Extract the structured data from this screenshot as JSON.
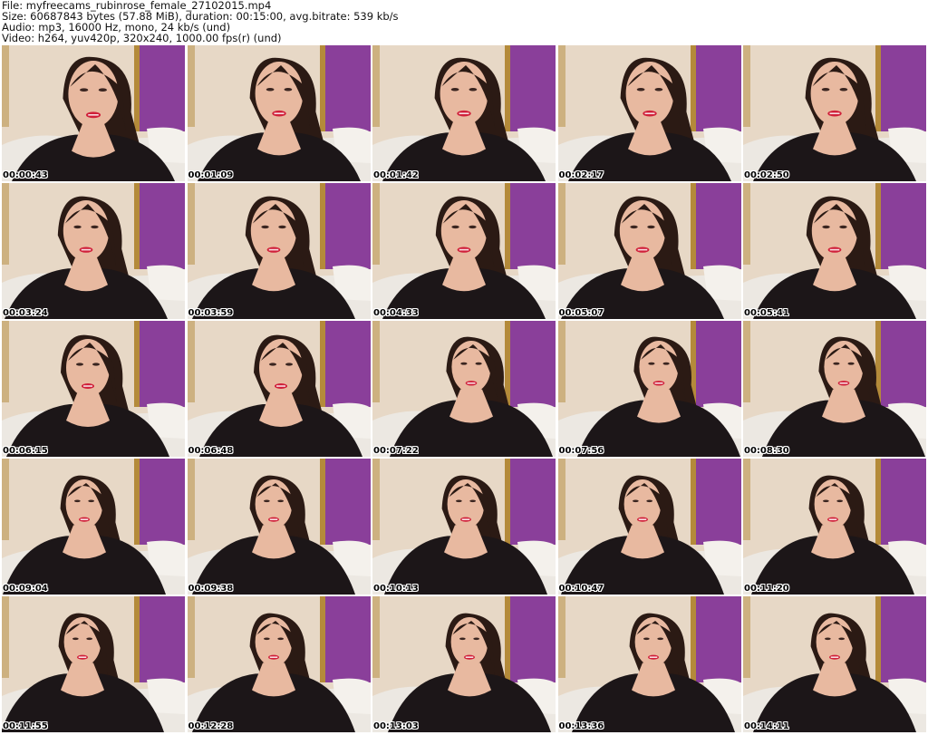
{
  "header": {
    "file_line": "File: myfreecams_rubinrose_female_27102015.mp4",
    "size_line": "Size: 60687843 bytes (57.88 MiB), duration: 00:15:00, avg.bitrate: 539 kb/s",
    "audio_line": "Audio: mp3, 16000 Hz, mono, 24 kb/s (und)",
    "video_line": "Video: h264, yuv420p, 320x240, 1000.00 fps(r) (und)"
  },
  "colors": {
    "wall_beige": "#e7d8c6",
    "curtain_purple": "#8a3f9a",
    "curtain_gold": "#b48a3a",
    "hair": "#2b1a14",
    "skin": "#e8b9a0",
    "top_black": "#1c1618",
    "lips": "#d0203a",
    "sofa": "#ece8e2"
  },
  "thumbnails": [
    {
      "timestamp": "00:00:43",
      "icon": "thumbnail-frame"
    },
    {
      "timestamp": "00:01:09",
      "icon": "thumbnail-frame"
    },
    {
      "timestamp": "00:01:42",
      "icon": "thumbnail-frame"
    },
    {
      "timestamp": "00:02:17",
      "icon": "thumbnail-frame"
    },
    {
      "timestamp": "00:02:50",
      "icon": "thumbnail-frame"
    },
    {
      "timestamp": "00:03:24",
      "icon": "thumbnail-frame"
    },
    {
      "timestamp": "00:03:59",
      "icon": "thumbnail-frame"
    },
    {
      "timestamp": "00:04:33",
      "icon": "thumbnail-frame"
    },
    {
      "timestamp": "00:05:07",
      "icon": "thumbnail-frame"
    },
    {
      "timestamp": "00:05:41",
      "icon": "thumbnail-frame"
    },
    {
      "timestamp": "00:06:15",
      "icon": "thumbnail-frame"
    },
    {
      "timestamp": "00:06:48",
      "icon": "thumbnail-frame"
    },
    {
      "timestamp": "00:07:22",
      "icon": "thumbnail-frame"
    },
    {
      "timestamp": "00:07:56",
      "icon": "thumbnail-frame"
    },
    {
      "timestamp": "00:08:30",
      "icon": "thumbnail-frame"
    },
    {
      "timestamp": "00:09:04",
      "icon": "thumbnail-frame"
    },
    {
      "timestamp": "00:09:38",
      "icon": "thumbnail-frame"
    },
    {
      "timestamp": "00:10:13",
      "icon": "thumbnail-frame"
    },
    {
      "timestamp": "00:10:47",
      "icon": "thumbnail-frame"
    },
    {
      "timestamp": "00:11:20",
      "icon": "thumbnail-frame"
    },
    {
      "timestamp": "00:11:55",
      "icon": "thumbnail-frame"
    },
    {
      "timestamp": "00:12:28",
      "icon": "thumbnail-frame"
    },
    {
      "timestamp": "00:13:03",
      "icon": "thumbnail-frame"
    },
    {
      "timestamp": "00:13:36",
      "icon": "thumbnail-frame"
    },
    {
      "timestamp": "00:14:11",
      "icon": "thumbnail-frame"
    }
  ]
}
